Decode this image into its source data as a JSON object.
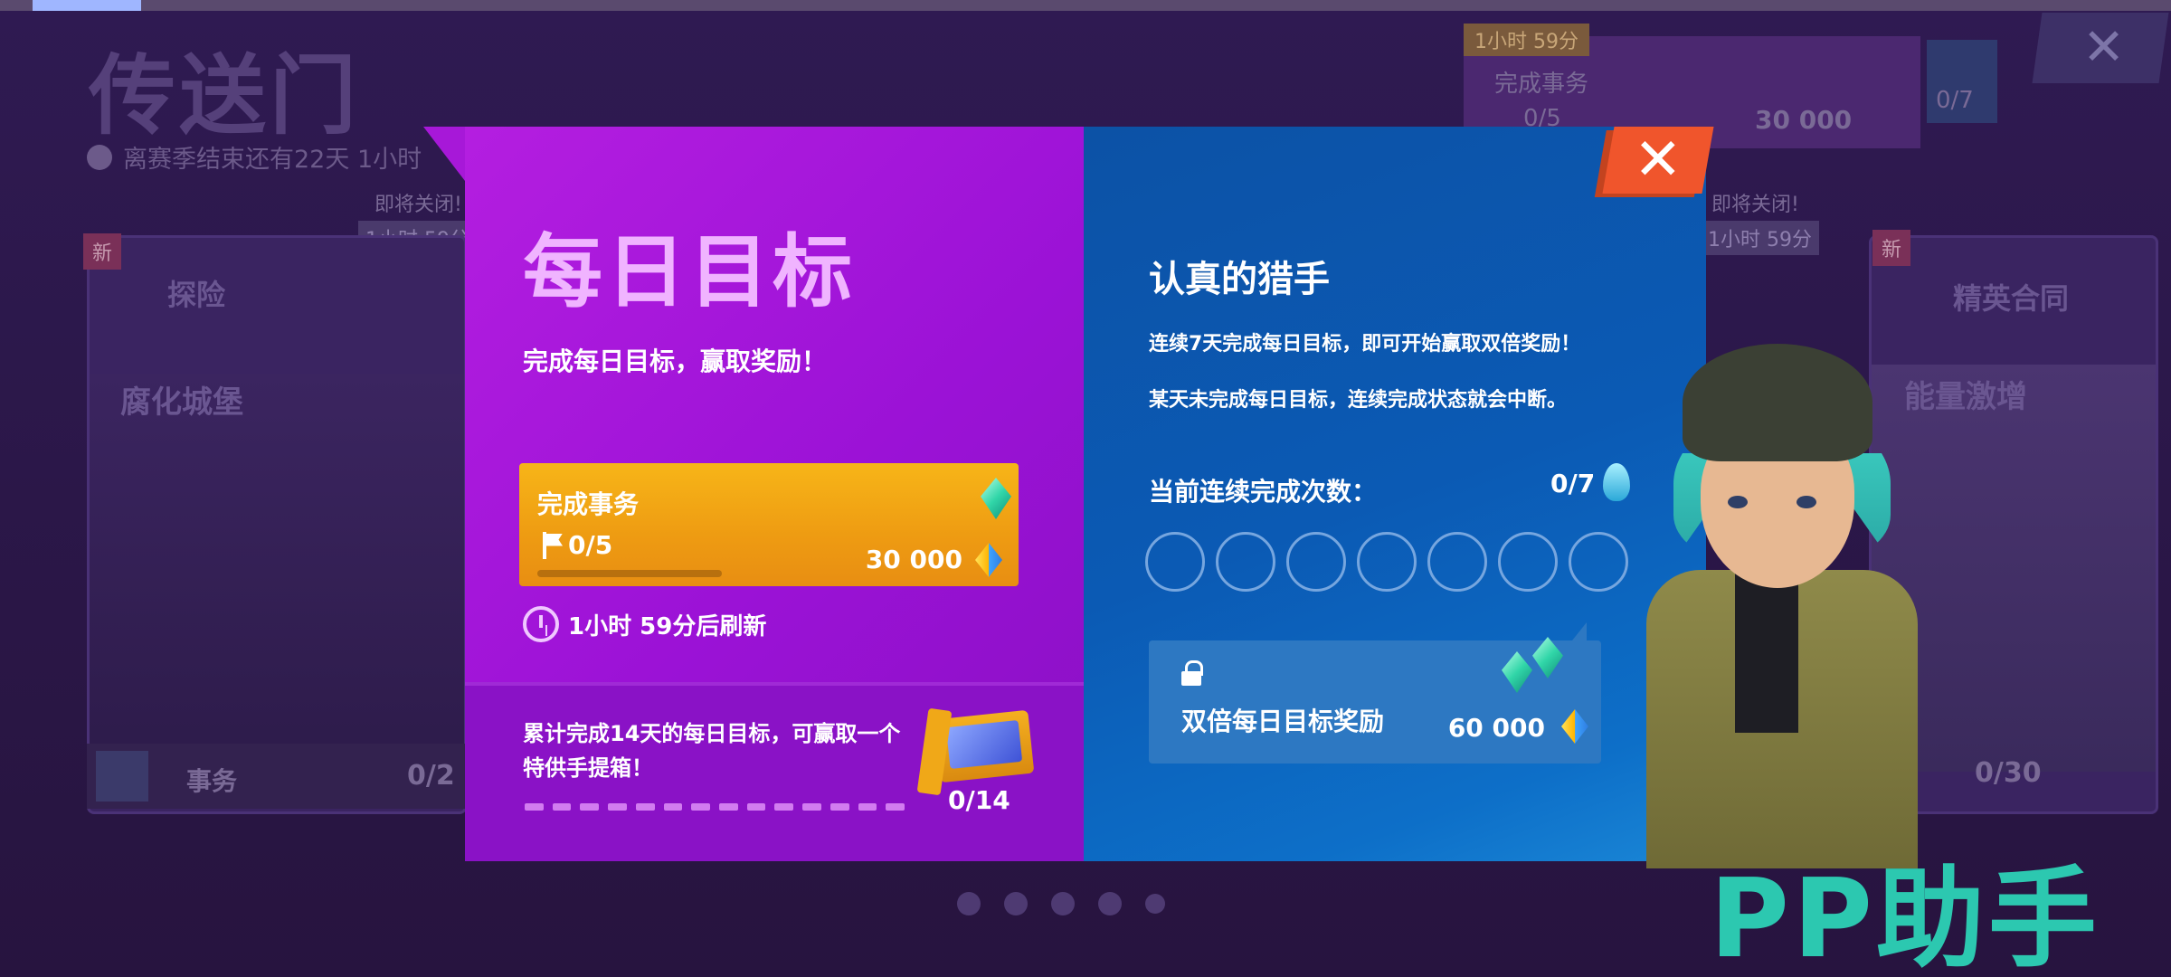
{
  "background": {
    "title": "传送门",
    "season_text": "离赛季结束还有22天 1小时",
    "closing_soon_left": "即将关闭!",
    "closing_time_left": "1小时 59分",
    "closing_soon_right": "即将关闭!",
    "closing_time_right": "1小时 59分",
    "new_badge": "新",
    "left_card": {
      "category": "探险",
      "name": "腐化城堡",
      "mission_label": "事务",
      "mission_count": "0/2"
    },
    "right_card": {
      "category": "精英合同",
      "name": "能量激增",
      "count": "0/30"
    },
    "top_right": {
      "time": "1小时 59分",
      "mission": "完成事务",
      "progress": "0/5",
      "reward": "30 000",
      "streak": "0/7"
    }
  },
  "modal": {
    "daily": {
      "title": "每日目标",
      "subtitle": "完成每日目标，赢取奖励！",
      "mission": {
        "name": "完成事务",
        "progress": "0/5",
        "progress_fraction": 0,
        "reward": "30 000"
      },
      "refresh": "1小时 59分后刷新",
      "cumulative_text": "累计完成14天的每日目标，可赢取一个特供手提箱！",
      "cumulative_count": "0/14"
    },
    "streak": {
      "title": "认真的猎手",
      "desc1": "连续7天完成每日目标，即可开始赢取双倍奖励！",
      "desc2": "某天未完成每日目标，连续完成状态就会中断。",
      "count_label": "当前连续完成次数：",
      "count": "0/7",
      "double_label": "双倍每日目标奖励",
      "double_reward": "60 000"
    },
    "close_label": "✕"
  },
  "watermark": "PP助手",
  "icons": [
    "flag-icon",
    "gem-icon",
    "diamond-icon",
    "clock-refresh-icon",
    "flame-icon",
    "lock-icon",
    "chest-icon",
    "close-icon"
  ],
  "colors": {
    "left_panel": "#9b12d6",
    "right_panel": "#0b5ab4",
    "mission_card": "#f2a414",
    "close": "#f0552c",
    "title_pink": "#f0b4ff"
  }
}
